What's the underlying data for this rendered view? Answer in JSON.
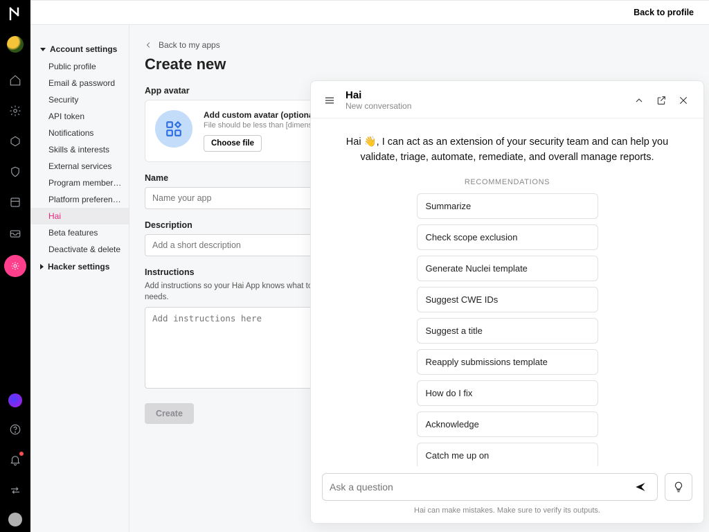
{
  "topbar": {
    "back_to_profile": "Back to profile"
  },
  "sidebar": {
    "account_head": "Account settings",
    "items": [
      "Public profile",
      "Email & password",
      "Security",
      "API token",
      "Notifications",
      "Skills & interests",
      "External services",
      "Program membersh...",
      "Platform preferences",
      "Hai",
      "Beta features",
      "Deactivate & delete"
    ],
    "active_index": 9,
    "hacker_head": "Hacker settings"
  },
  "main": {
    "back": "Back to my apps",
    "title": "Create new",
    "avatar": {
      "label": "App avatar",
      "card_title": "Add custom avatar (optional)",
      "card_hint": "File should be less than [dimensions] and si",
      "choose": "Choose file"
    },
    "name": {
      "label": "Name",
      "placeholder": "Name your app"
    },
    "description": {
      "label": "Description",
      "placeholder": "Add a short description"
    },
    "instructions": {
      "label": "Instructions",
      "help": "Add instructions so your Hai App knows what to do and how to behave. If you're not sure where to start, choose a template, and then edit it to meet your needs.",
      "placeholder": "Add instructions here"
    },
    "create": "Create"
  },
  "hai": {
    "title": "Hai",
    "subtitle": "New conversation",
    "intro_prefix": "Hai ",
    "intro_wave": "👋",
    "intro_suffix": ", I can act as an extension of your security team and can help you validate, triage, automate, remediate, and overall manage reports.",
    "rec_head": "RECOMMENDATIONS",
    "recs": [
      "Summarize",
      "Check scope exclusion",
      "Generate Nuclei template",
      "Suggest CWE IDs",
      "Suggest a title",
      "Reapply submissions template",
      "How do I fix",
      "Acknowledge",
      "Catch me up on"
    ],
    "ask_placeholder": "Ask a question",
    "disclaimer": "Hai can make mistakes. Make sure to verify its outputs."
  }
}
